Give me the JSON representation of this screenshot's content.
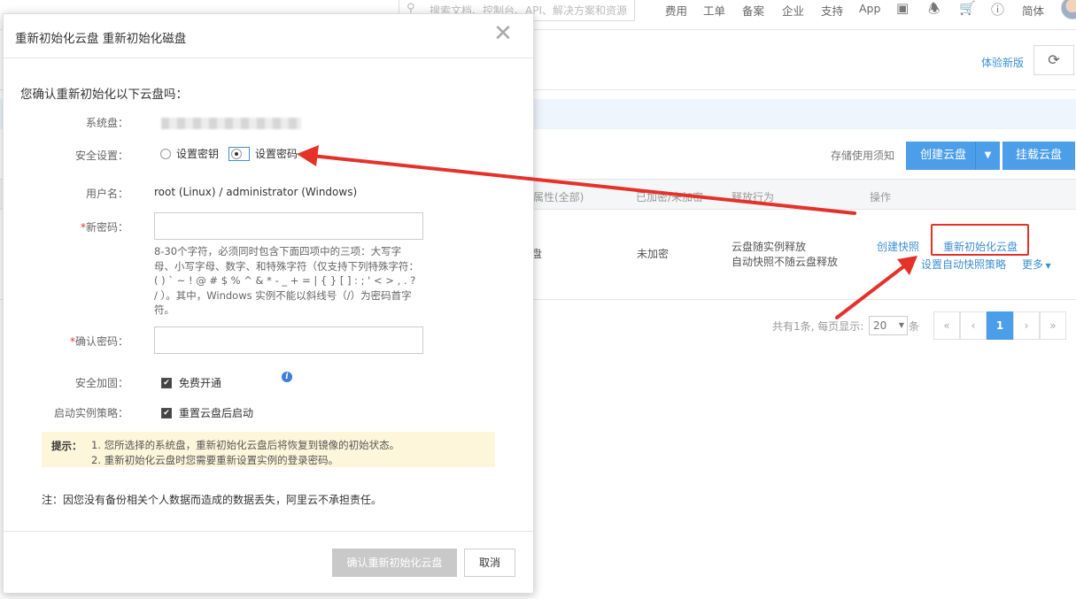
{
  "topbar": {
    "search_placeholder": "搜索文档、控制台、API、解决方案和资源",
    "nav": [
      "费用",
      "工单",
      "备案",
      "企业",
      "支持",
      "App"
    ],
    "lang": "简体"
  },
  "header": {
    "try_new": "体验新版"
  },
  "toolbar": {
    "storage_notice": "存储使用须知",
    "create_label": "创建云盘",
    "mount_label": "挂载云盘"
  },
  "table": {
    "headers": [
      "属性(全部)",
      "已加密/未加密",
      "释放行为",
      "操作"
    ],
    "row": {
      "attr": "盘",
      "encryption": "未加密",
      "release": [
        "云盘随实例释放",
        "自动快照不随云盘释放"
      ],
      "actions": {
        "snapshot": "创建快照",
        "reinit": "重新初始化云盘",
        "auto_snapshot": "设置自动快照策略",
        "more": "更多"
      }
    }
  },
  "pager": {
    "summary": "共有1条, 每页显示:",
    "page_size": "20",
    "unit": "条",
    "buttons": [
      "«",
      "‹",
      "1",
      "›",
      "»"
    ]
  },
  "modal": {
    "title": "重新初始化云盘 重新初始化磁盘",
    "question": "您确认重新初始化以下云盘吗：",
    "system_disk_label": "系统盘：",
    "security_label": "安全设置：",
    "option_key": "设置密钥",
    "option_password": "设置密码",
    "username_label": "用户名：",
    "username_value": "root (Linux) / administrator (Windows)",
    "new_pwd_label": "新密码：",
    "pwd_hint": "8-30个字符，必须同时包含下面四项中的三项：大写字母、小写字母、数字、和特殊字符（仅支持下列特殊字符：( ) ` ~ ! @ # $ % ^ & * - _ + = | { } [ ] : ; ' < > , . ? / ）。其中，Windows 实例不能以斜线号（/）为密码首字符。",
    "confirm_pwd_label": "确认密码：",
    "harden_label": "安全加固：",
    "harden_value": "免费开通",
    "start_label": "启动实例策略：",
    "start_value": "重置云盘后启动",
    "tip_label": "提示：",
    "tips": [
      "1. 您所选择的系统盘，重新初始化云盘后将恢复到镜像的初始状态。",
      "2. 重新初始化云盘时您需要重新设置实例的登录密码。"
    ],
    "note": "注：因您没有备份相关个人数据而造成的数据丢失，阿里云不承担责任。",
    "confirm_button": "确认重新初始化云盘",
    "cancel_button": "取消"
  },
  "colors": {
    "accent": "#4d9ee8",
    "annotation": "#e4322b",
    "tip_bg": "#fdf6db"
  }
}
